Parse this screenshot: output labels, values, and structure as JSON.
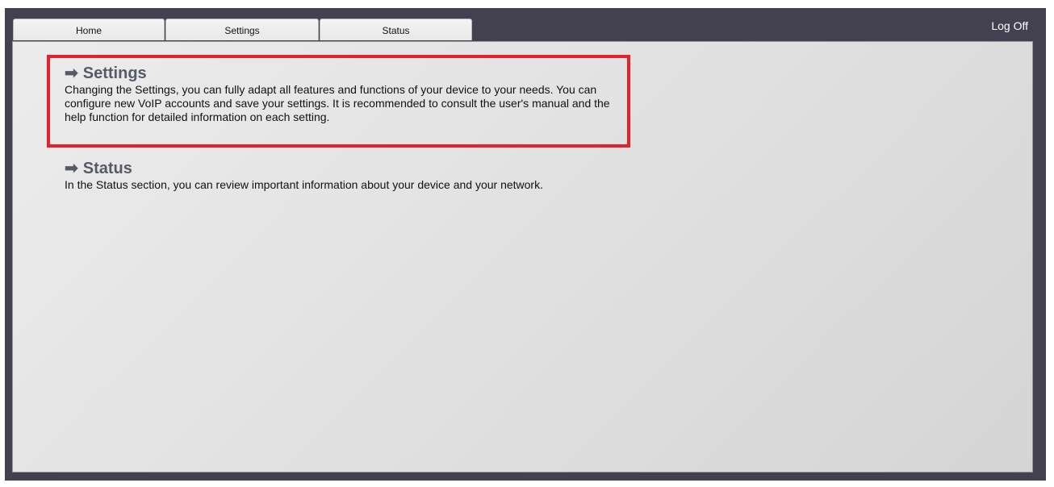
{
  "tabs": [
    {
      "label": "Home"
    },
    {
      "label": "Settings"
    },
    {
      "label": "Status"
    }
  ],
  "header": {
    "logoff_label": "Log Off"
  },
  "sections": [
    {
      "arrow": "➡",
      "title": "Settings",
      "text": "Changing the Settings, you can fully adapt all features and functions of your device to your needs. You can configure new VoIP accounts and save your settings. It is recommended to consult the user's manual and the help function for detailed information on each setting."
    },
    {
      "arrow": "➡",
      "title": "Status",
      "text": "In the Status section, you can review important information about your device and your network."
    }
  ],
  "colors": {
    "frame": "#43404f",
    "highlight": "#e8202a",
    "heading": "#555b66"
  }
}
